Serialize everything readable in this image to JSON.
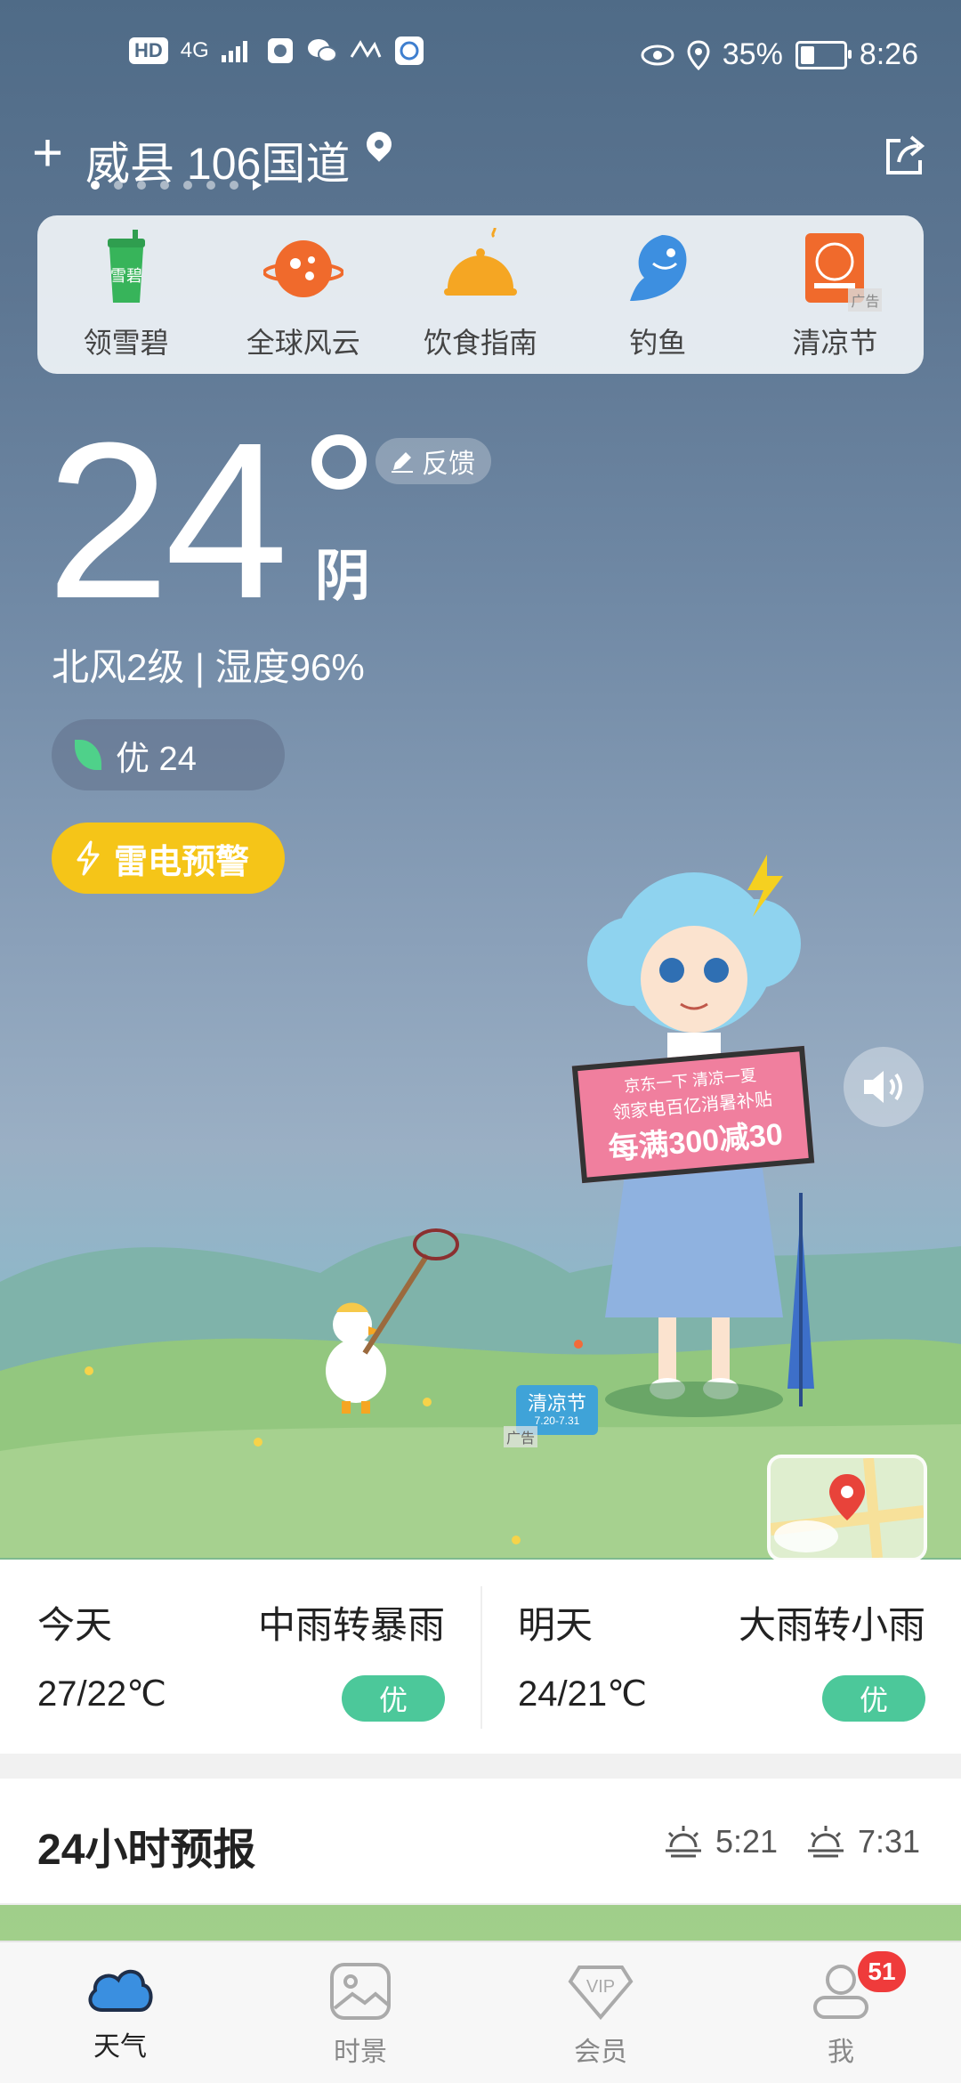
{
  "status_bar": {
    "network_hd": "HD",
    "network_4g": "4G",
    "battery_percent": "35%",
    "time": "8:26",
    "battery_level": 0.35
  },
  "header": {
    "location": "威县 106国道",
    "page_count": 7,
    "active_page": 0
  },
  "shortcuts": [
    {
      "label": "领雪碧",
      "icon": "sprite-drink-icon"
    },
    {
      "label": "全球风云",
      "icon": "planet-icon"
    },
    {
      "label": "饮食指南",
      "icon": "food-dome-icon"
    },
    {
      "label": "钓鱼",
      "icon": "fish-icon"
    },
    {
      "label": "清凉节",
      "icon": "festival-icon",
      "ad_tag": "广告"
    }
  ],
  "current": {
    "temperature": "24",
    "condition": "阴",
    "feedback_label": "反馈",
    "wind_humidity": "北风2级 | 湿度96%",
    "aqi_label": "优 24",
    "warning_label": "雷电预警"
  },
  "scene": {
    "ad_lines": [
      "京东一下 清凉一夏",
      "领家电百亿消暑补贴",
      "每满300减30"
    ],
    "festival_tag": "清凉节",
    "festival_sub": "7.20-7.31",
    "ad_label": "广告"
  },
  "days": [
    {
      "name": "今天",
      "condition": "中雨转暴雨",
      "range": "27/22℃",
      "aqi": "优"
    },
    {
      "name": "明天",
      "condition": "大雨转小雨",
      "range": "24/21℃",
      "aqi": "优"
    }
  ],
  "forecast": {
    "title": "24小时预报",
    "sunrise": "5:21",
    "sunset": "7:31"
  },
  "tabs": [
    {
      "label": "天气",
      "icon": "cloud-icon",
      "active": true
    },
    {
      "label": "时景",
      "icon": "picture-icon",
      "active": false
    },
    {
      "label": "会员",
      "icon": "vip-icon",
      "active": false
    },
    {
      "label": "我",
      "icon": "user-icon",
      "active": false,
      "badge": "51"
    }
  ],
  "colors": {
    "accent_yellow": "#f5c518",
    "aqi_green": "#4cc89a",
    "badge_red": "#ef3b3b"
  }
}
